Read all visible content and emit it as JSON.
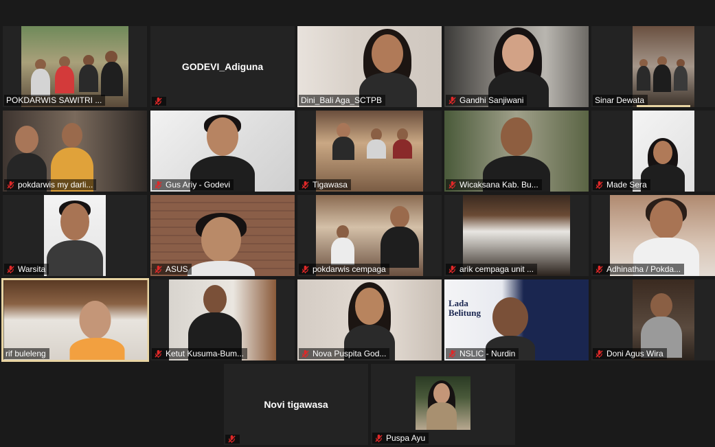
{
  "participants": [
    {
      "name": "POKDARWIS SAWITRI ...",
      "muted": false,
      "kind": "group"
    },
    {
      "name": "GODEVI_Adiguna",
      "muted": true,
      "kind": "nametile",
      "display": "GODEVI_Adiguna"
    },
    {
      "name": "Dini_Bali Aga_SCTPB",
      "muted": false,
      "kind": "woman"
    },
    {
      "name": "Gandhi Sanjiwani",
      "muted": true,
      "kind": "woman"
    },
    {
      "name": "Sinar Dewata",
      "muted": false,
      "kind": "group"
    },
    {
      "name": "pokdarwis my darli...",
      "muted": true,
      "kind": "group"
    },
    {
      "name": "Gus Ariy - Godevi",
      "muted": true,
      "kind": "man"
    },
    {
      "name": "Tigawasa",
      "muted": true,
      "kind": "group"
    },
    {
      "name": "Wicaksana Kab. Bu...",
      "muted": true,
      "kind": "man"
    },
    {
      "name": "Made Sera",
      "muted": true,
      "kind": "woman"
    },
    {
      "name": "Warsita",
      "muted": true,
      "kind": "man"
    },
    {
      "name": "ASUS",
      "muted": true,
      "kind": "man"
    },
    {
      "name": "pokdarwis cempaga",
      "muted": true,
      "kind": "group"
    },
    {
      "name": "arik cempaga unit ...",
      "muted": true,
      "kind": "scene"
    },
    {
      "name": "Adhinatha / Pokda...",
      "muted": true,
      "kind": "man"
    },
    {
      "name": "rif buleleng",
      "muted": false,
      "kind": "man"
    },
    {
      "name": "Ketut Kusuma-Bum...",
      "muted": true,
      "kind": "man"
    },
    {
      "name": "Nova Puspita God...",
      "muted": true,
      "kind": "woman"
    },
    {
      "name": "NSLIC - Nurdin",
      "muted": true,
      "kind": "banner",
      "banner_title": "Lada Belitung"
    },
    {
      "name": "Doni Agus Wira",
      "muted": true,
      "kind": "man"
    },
    {
      "name": "Novi tigawasa",
      "muted": true,
      "kind": "nametile",
      "display": "Novi tigawasa"
    },
    {
      "name": "Puspa Ayu",
      "muted": true,
      "kind": "woman"
    }
  ],
  "colors": {
    "background": "#1a1a1a",
    "tile": "#232323",
    "active_border": "#e8d4a2",
    "mute_red": "#e02828"
  }
}
